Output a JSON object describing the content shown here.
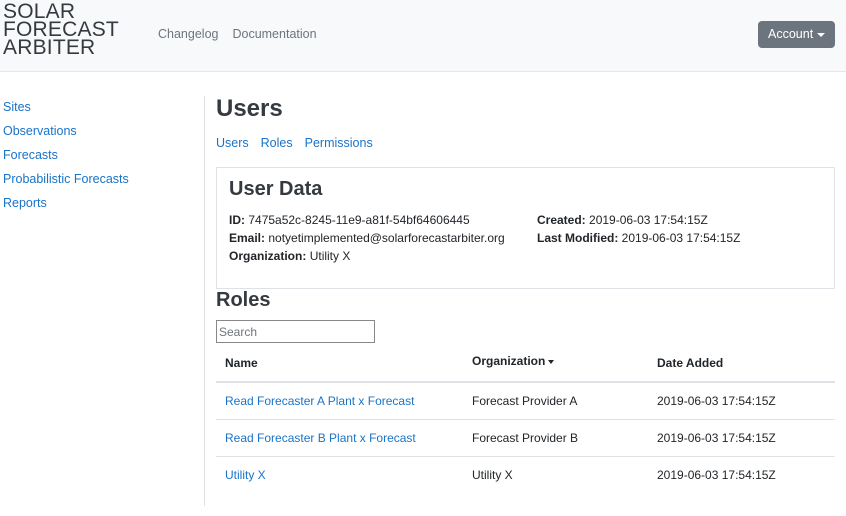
{
  "brand": {
    "line1": "SOLAR",
    "line2": "FORECAST",
    "line3": "ARBITER"
  },
  "topnav": {
    "changelog": "Changelog",
    "documentation": "Documentation"
  },
  "account": {
    "label": "Account"
  },
  "sidebar": {
    "items": [
      {
        "label": "Sites"
      },
      {
        "label": "Observations"
      },
      {
        "label": "Forecasts"
      },
      {
        "label": "Probabilistic Forecasts"
      },
      {
        "label": "Reports"
      }
    ]
  },
  "main": {
    "title": "Users",
    "subnav": {
      "users": "Users",
      "roles": "Roles",
      "permissions": "Permissions"
    }
  },
  "user_data": {
    "title": "User Data",
    "id_label": "ID:",
    "id_value": "7475a52c-8245-11e9-a81f-54bf64606445",
    "email_label": "Email:",
    "email_value": "notyetimplemented@solarforecastarbiter.org",
    "org_label": "Organization:",
    "org_value": "Utility X",
    "created_label": "Created:",
    "created_value": "2019-06-03 17:54:15Z",
    "modified_label": "Last Modified:",
    "modified_value": "2019-06-03 17:54:15Z"
  },
  "roles": {
    "title": "Roles",
    "search_placeholder": "Search",
    "columns": {
      "name": "Name",
      "organization": "Organization",
      "date_added": "Date Added"
    },
    "rows": [
      {
        "name": "Read Forecaster A Plant x Forecast",
        "organization": "Forecast Provider A",
        "date_added": "2019-06-03 17:54:15Z"
      },
      {
        "name": "Read Forecaster B Plant x Forecast",
        "organization": "Forecast Provider B",
        "date_added": "2019-06-03 17:54:15Z"
      },
      {
        "name": "Utility X",
        "organization": "Utility X",
        "date_added": "2019-06-03 17:54:15Z"
      }
    ]
  },
  "colors": {
    "link": "#1a73c8",
    "navbar_bg": "#f8f9fa",
    "account_button_bg": "#6c757d"
  }
}
